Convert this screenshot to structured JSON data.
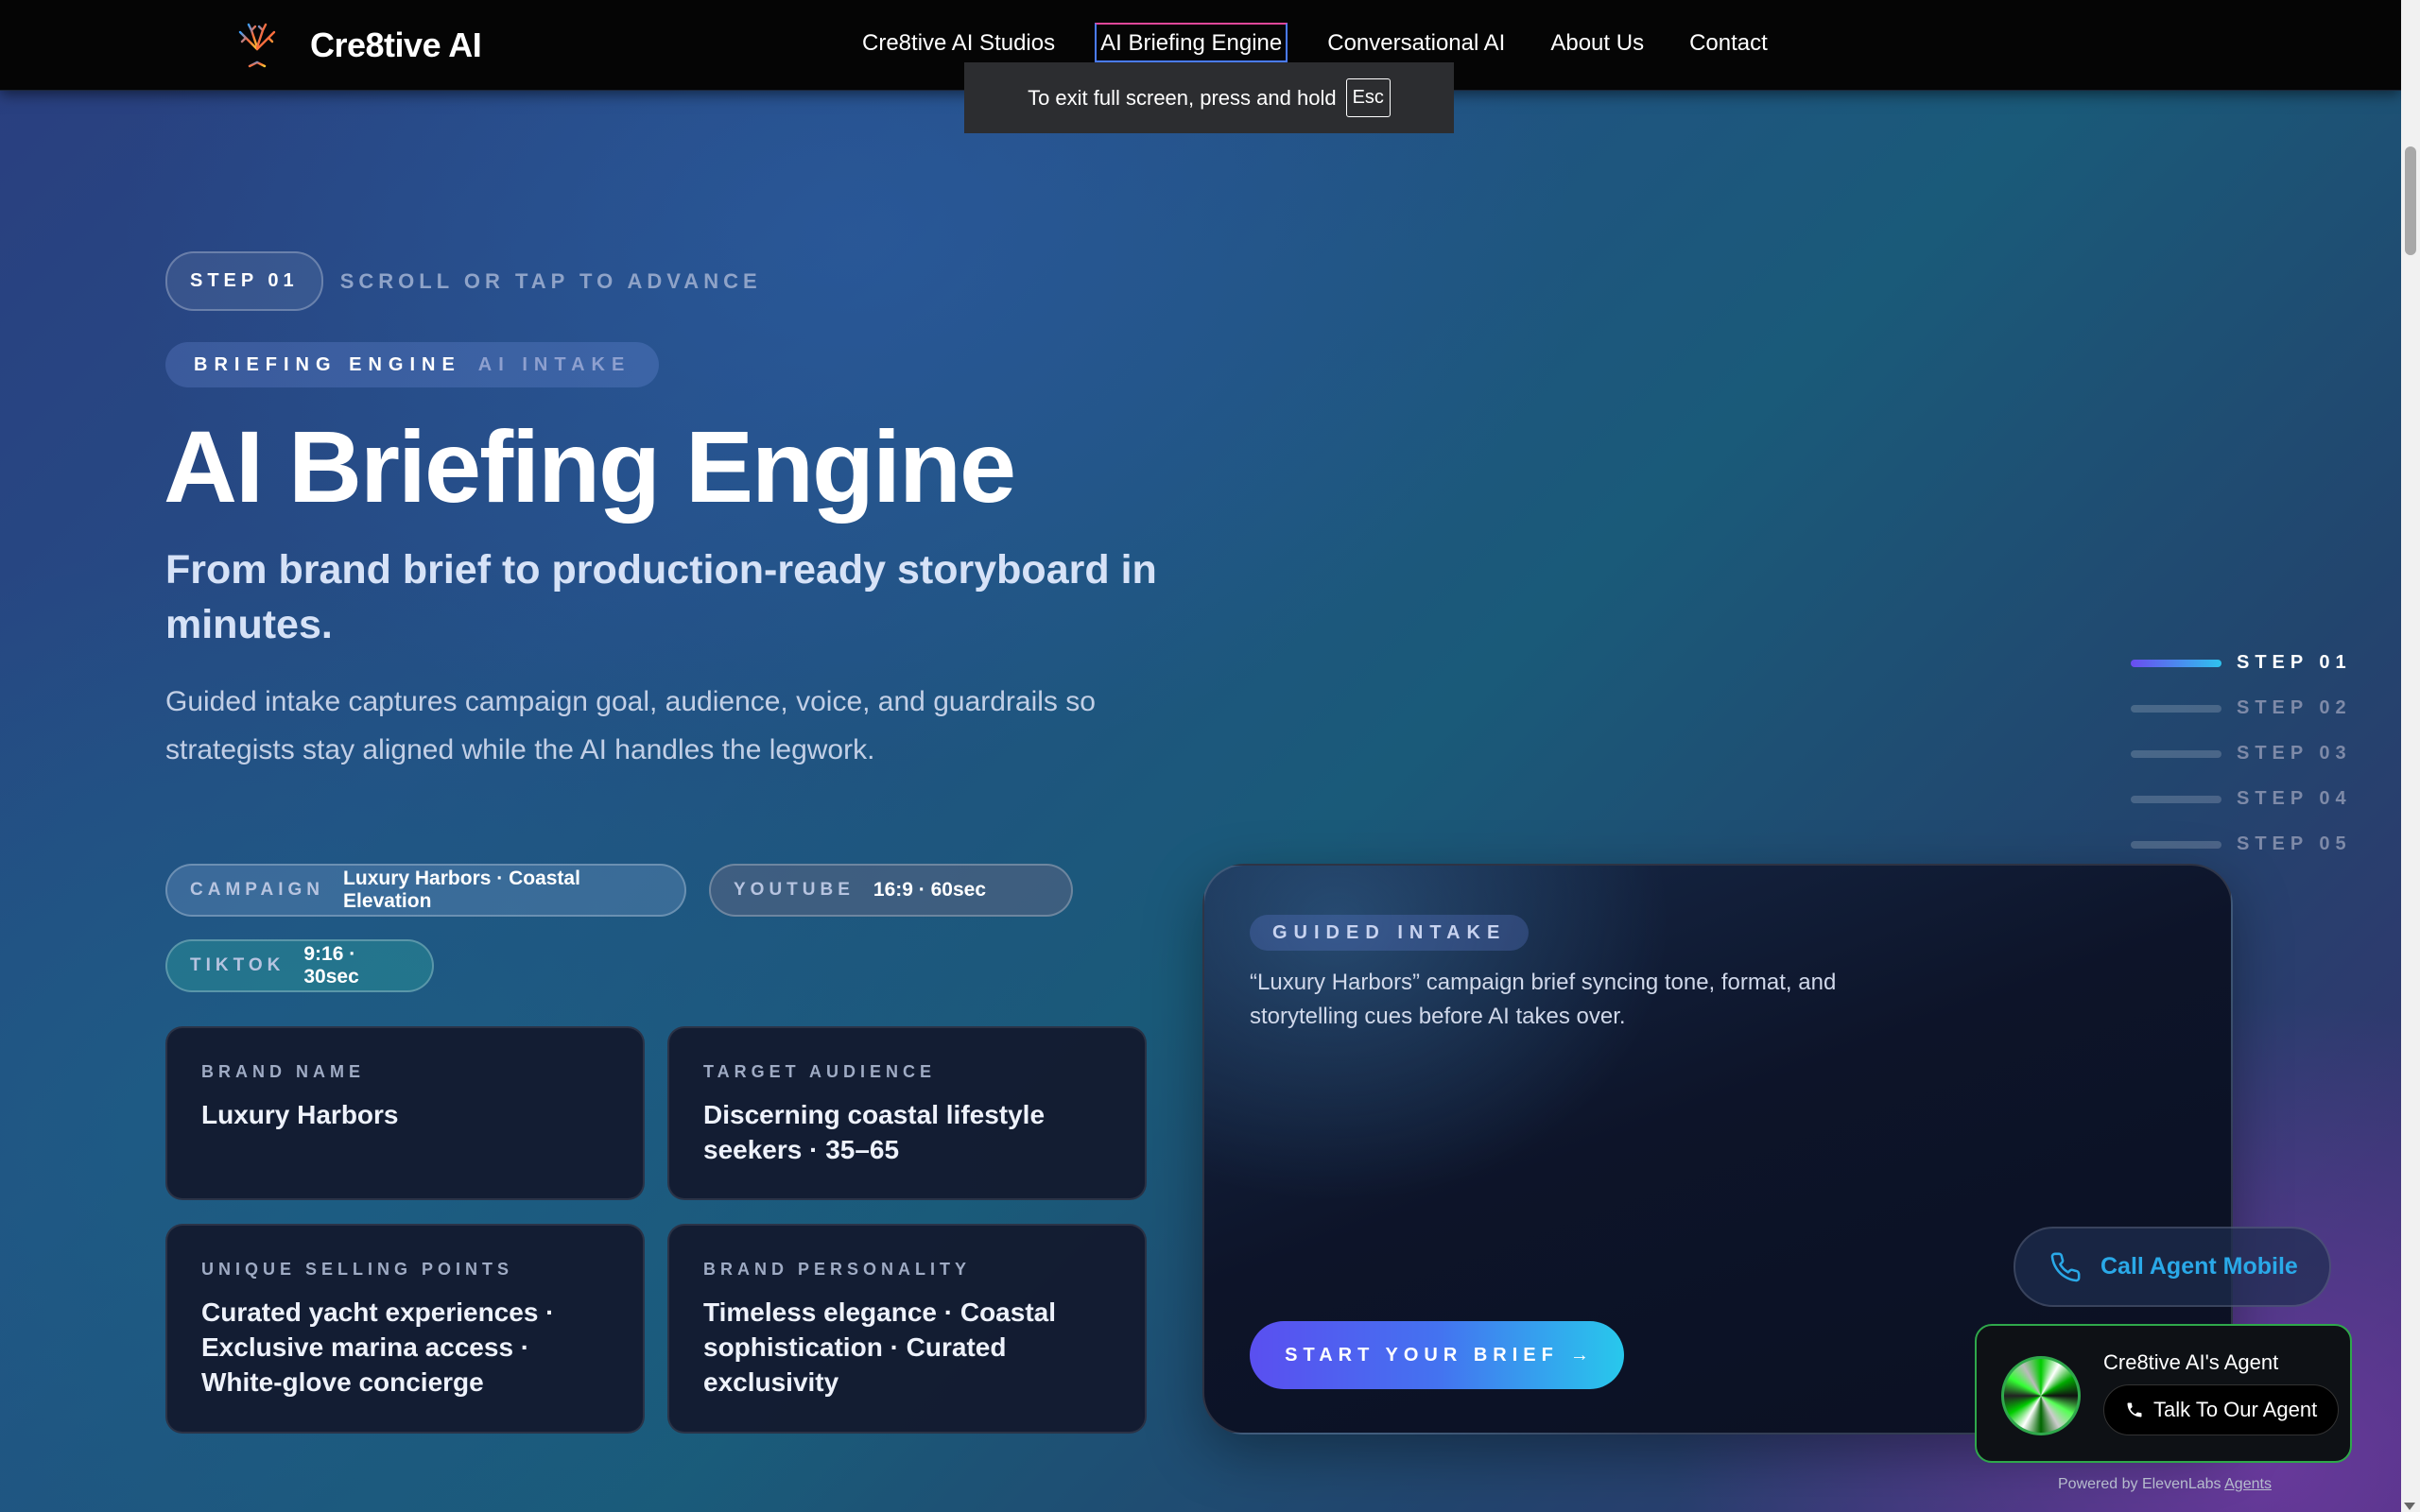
{
  "nav": {
    "brand": "Cre8tive AI",
    "links": [
      "Cre8tive AI Studios",
      "AI Briefing Engine",
      "Conversational AI",
      "About Us",
      "Contact"
    ],
    "active_index": 1
  },
  "fullscreen_toast": {
    "text": "To exit full screen, press and hold",
    "key": "Esc"
  },
  "hero": {
    "step_pill": "STEP 01",
    "step_hint": "SCROLL OR TAP TO ADVANCE",
    "eyebrow_main": "BRIEFING ENGINE",
    "eyebrow_dim": "AI INTAKE",
    "title": "AI Briefing Engine",
    "subtitle": "From brand brief to production-ready storyboard in minutes.",
    "description": "Guided intake captures campaign goal, audience, voice, and guardrails so strategists stay aligned while the AI handles the legwork."
  },
  "chips": [
    {
      "key": "CAMPAIGN",
      "value": "Luxury Harbors · Coastal Elevation"
    },
    {
      "key": "YOUTUBE",
      "value": "16:9 · 60sec"
    },
    {
      "key": "TIKTOK",
      "value": "9:16 · 30sec"
    }
  ],
  "cards": [
    {
      "label": "BRAND NAME",
      "value": "Luxury Harbors"
    },
    {
      "label": "TARGET AUDIENCE",
      "value": "Discerning coastal lifestyle seekers · 35–65"
    },
    {
      "label": "UNIQUE SELLING POINTS",
      "value": "Curated yacht experiences · Exclusive marina access · White-glove concierge"
    },
    {
      "label": "BRAND PERSONALITY",
      "value": "Timeless elegance · Coastal sophistication · Curated exclusivity"
    }
  ],
  "panel": {
    "tag": "GUIDED INTAKE",
    "text": "“Luxury Harbors” campaign brief syncing tone, format, and storytelling cues before AI takes over.",
    "cta": "START YOUR BRIEF",
    "cta_arrow": "→"
  },
  "steps": [
    "STEP 01",
    "STEP 02",
    "STEP 03",
    "STEP 04",
    "STEP 05"
  ],
  "active_step": 0,
  "agent": {
    "call_label": "Call Agent Mobile",
    "title": "Cre8tive AI's Agent",
    "button": "Talk To Our Agent",
    "powered_prefix": "Powered by ElevenLabs",
    "powered_link": "Agents"
  },
  "colors": {
    "accent_blue": "#2aa9e8",
    "cta_start": "#5a4ff0",
    "cta_end": "#28c8ec",
    "agent_border": "#2fa84b"
  }
}
